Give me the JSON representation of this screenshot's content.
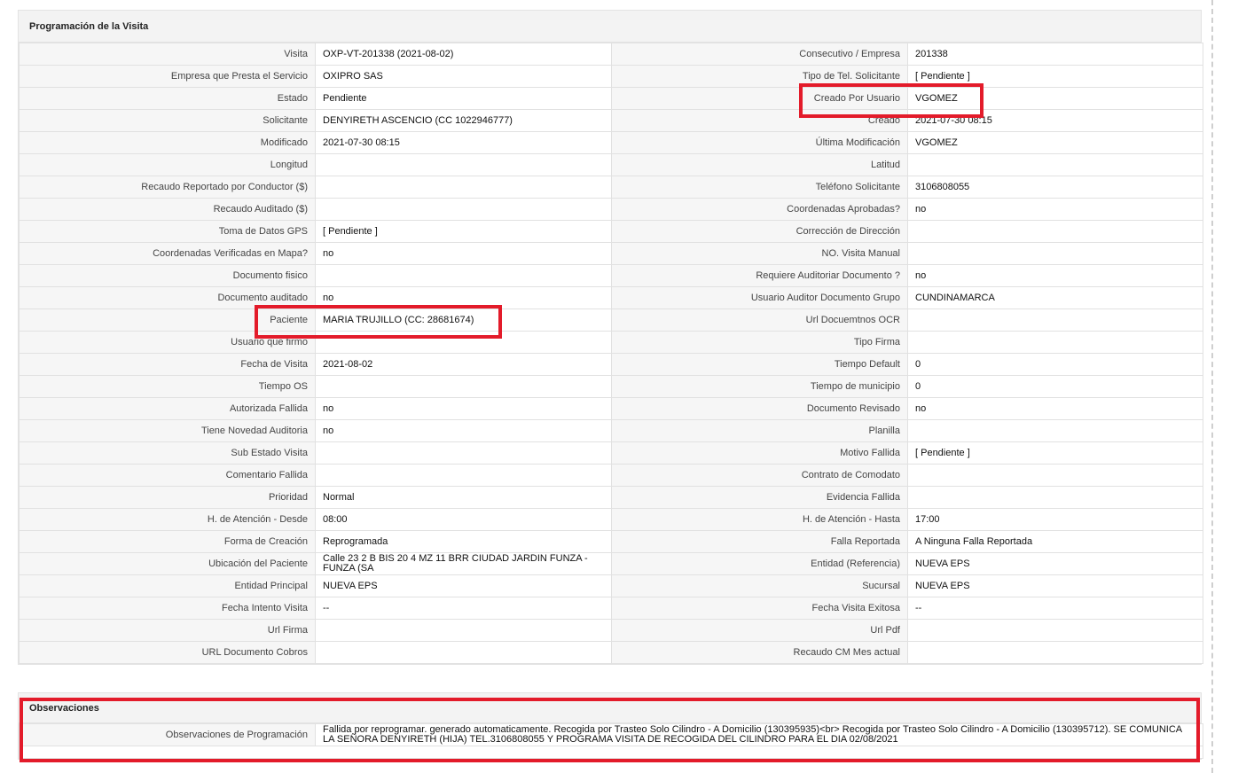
{
  "visit_panel": {
    "title": "Programación de la Visita",
    "rows": [
      [
        {
          "l": "Visita",
          "v": "OXP-VT-201338 (2021-08-02)"
        },
        {
          "l": "Consecutivo / Empresa",
          "v": "201338"
        }
      ],
      [
        {
          "l": "Empresa que Presta el Servicio",
          "v": "OXIPRO SAS"
        },
        {
          "l": "Tipo de Tel. Solicitante",
          "v": "[ Pendiente ]"
        }
      ],
      [
        {
          "l": "Estado",
          "v": "Pendiente"
        },
        {
          "l": "Creado Por Usuario",
          "v": "VGOMEZ"
        }
      ],
      [
        {
          "l": "Solicitante",
          "v": "DENYIRETH ASCENCIO (CC 1022946777)"
        },
        {
          "l": "Creado",
          "v": "2021-07-30 08:15"
        }
      ],
      [
        {
          "l": "Modificado",
          "v": "2021-07-30 08:15"
        },
        {
          "l": "Última Modificación",
          "v": " VGOMEZ"
        }
      ],
      [
        {
          "l": "Longitud",
          "v": ""
        },
        {
          "l": "Latitud",
          "v": ""
        }
      ],
      [
        {
          "l": "Recaudo Reportado por Conductor ($)",
          "v": ""
        },
        {
          "l": "Teléfono Solicitante",
          "v": "3106808055"
        }
      ],
      [
        {
          "l": "Recaudo Auditado ($)",
          "v": ""
        },
        {
          "l": "Coordenadas Aprobadas?",
          "v": " no"
        }
      ],
      [
        {
          "l": "Toma de Datos GPS",
          "v": "[ Pendiente ]"
        },
        {
          "l": "Corrección de Dirección",
          "v": ""
        }
      ],
      [
        {
          "l": "Coordenadas Verificadas en Mapa?",
          "v": " no"
        },
        {
          "l": "NO. Visita Manual",
          "v": ""
        }
      ],
      [
        {
          "l": "Documento fisico",
          "v": ""
        },
        {
          "l": "Requiere Auditoriar Documento ?",
          "v": " no"
        }
      ],
      [
        {
          "l": "Documento auditado",
          "v": " no"
        },
        {
          "l": "Usuario Auditor Documento Grupo",
          "v": "CUNDINAMARCA"
        }
      ],
      [
        {
          "l": "Paciente",
          "v": "MARIA TRUJILLO (CC: 28681674)"
        },
        {
          "l": "Url Docuemtnos OCR",
          "v": ""
        }
      ],
      [
        {
          "l": "Usuario que firmo",
          "v": ""
        },
        {
          "l": "Tipo Firma",
          "v": ""
        }
      ],
      [
        {
          "l": "Fecha de Visita",
          "v": " 2021-08-02"
        },
        {
          "l": "Tiempo Default",
          "v": "0"
        }
      ],
      [
        {
          "l": "Tiempo OS",
          "v": ""
        },
        {
          "l": "Tiempo de municipio",
          "v": "0"
        }
      ],
      [
        {
          "l": "Autorizada Fallida",
          "v": " no"
        },
        {
          "l": "Documento Revisado",
          "v": " no"
        }
      ],
      [
        {
          "l": "Tiene Novedad Auditoria",
          "v": " no"
        },
        {
          "l": "Planilla",
          "v": ""
        }
      ],
      [
        {
          "l": "Sub Estado Visita",
          "v": ""
        },
        {
          "l": "Motivo Fallida",
          "v": "[ Pendiente ]"
        }
      ],
      [
        {
          "l": "Comentario Fallida",
          "v": ""
        },
        {
          "l": "Contrato de Comodato",
          "v": ""
        }
      ],
      [
        {
          "l": "Prioridad",
          "v": "Normal"
        },
        {
          "l": "Evidencia Fallida",
          "v": ""
        }
      ],
      [
        {
          "l": "H. de Atención - Desde",
          "v": "08:00"
        },
        {
          "l": "H. de Atención - Hasta",
          "v": "17:00"
        }
      ],
      [
        {
          "l": "Forma de Creación",
          "v": "Reprogramada"
        },
        {
          "l": "Falla Reportada",
          "v": "A Ninguna Falla Reportada"
        }
      ],
      [
        {
          "l": "Ubicación del Paciente",
          "v": "Calle 23 2 B BIS 20 4 MZ 11 BRR CIUDAD JARDIN FUNZA - FUNZA (SA"
        },
        {
          "l": "Entidad (Referencia)",
          "v": "NUEVA EPS"
        }
      ],
      [
        {
          "l": "Entidad Principal",
          "v": "NUEVA EPS"
        },
        {
          "l": "Sucursal",
          "v": "NUEVA EPS"
        }
      ],
      [
        {
          "l": "Fecha Intento Visita",
          "v": " --"
        },
        {
          "l": "Fecha Visita Exitosa",
          "v": " --"
        }
      ],
      [
        {
          "l": "Url Firma",
          "v": ""
        },
        {
          "l": "Url Pdf",
          "v": ""
        }
      ],
      [
        {
          "l": "URL Documento Cobros",
          "v": ""
        },
        {
          "l": "Recaudo CM Mes actual",
          "v": ""
        }
      ]
    ]
  },
  "observations_panel": {
    "title": "Observaciones",
    "label": "Observaciones de Programación",
    "value": "  Fallida por reprogramar. generado automaticamente. Recogida por Trasteo Solo Cilindro - A Domicilio (130395935)<br> Recogida por Trasteo Solo Cilindro - A Domicilio (130395712). SE COMUNICA LA SEÑORA DENYIRETH (HIJA) TEL.3106808055 Y PROGRAMA VISITA DE RECOGIDA DEL CILINDRO PARA EL DIA 02/08/2021"
  },
  "colors": {
    "highlight": "#e31b2a",
    "label_bg": "#f6f6f6",
    "header_bg": "#f3f3f3"
  }
}
